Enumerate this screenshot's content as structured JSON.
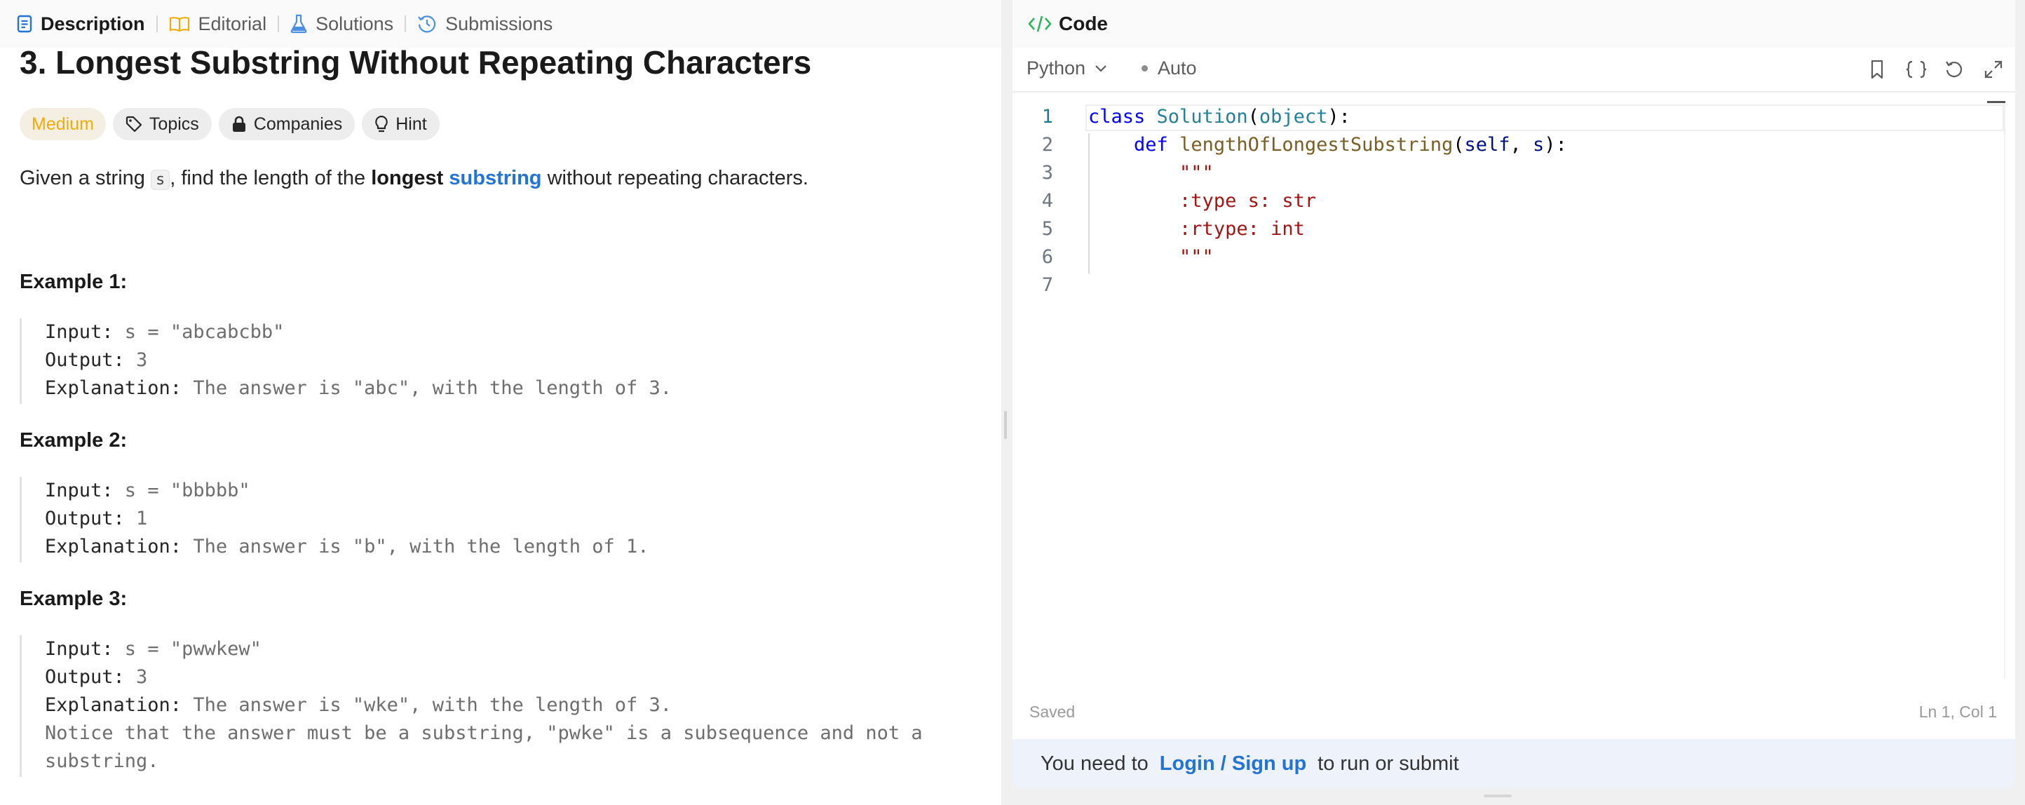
{
  "left_tabs": [
    {
      "label": "Description",
      "icon": "document-icon",
      "active": true
    },
    {
      "label": "Editorial",
      "icon": "book-icon"
    },
    {
      "label": "Solutions",
      "icon": "flask-icon"
    },
    {
      "label": "Submissions",
      "icon": "history-icon"
    }
  ],
  "problem": {
    "title": "3. Longest Substring Without Repeating Characters",
    "difficulty": "Medium",
    "chips": [
      "Topics",
      "Companies",
      "Hint"
    ],
    "desc_prefix": "Given a string ",
    "desc_code": "s",
    "desc_middle": ", find the length of the ",
    "desc_bold": "longest",
    "desc_link": "substring",
    "desc_suffix": " without repeating characters."
  },
  "examples": [
    {
      "title": "Example 1:",
      "input_label": "Input:",
      "input": " s = \"abcabcbb\"",
      "output_label": "Output:",
      "output": " 3",
      "explanation_label": "Explanation:",
      "explanation": " The answer is \"abc\", with the length of 3."
    },
    {
      "title": "Example 2:",
      "input_label": "Input:",
      "input": " s = \"bbbbb\"",
      "output_label": "Output:",
      "output": " 1",
      "explanation_label": "Explanation:",
      "explanation": " The answer is \"b\", with the length of 1."
    },
    {
      "title": "Example 3:",
      "input_label": "Input:",
      "input": " s = \"pwwkew\"",
      "output_label": "Output:",
      "output": " 3",
      "explanation_label": "Explanation:",
      "explanation": " The answer is \"wke\", with the length of 3.",
      "note_line1": "Notice that the answer must be a substring, \"pwke\" is a subsequence and not a",
      "note_line2": "substring."
    }
  ],
  "code_panel": {
    "tab_label": "Code",
    "language": "Python",
    "mode": "Auto",
    "line_numbers": [
      "1",
      "2",
      "3",
      "4",
      "5",
      "6",
      "7"
    ],
    "lines": {
      "l1_kw": "class",
      "l1_cls": "Solution",
      "l1_p1": "(",
      "l1_base": "object",
      "l1_p2": "):",
      "l2_kw": "def",
      "l2_fn": "lengthOfLongestSubstring",
      "l2_p1": "(",
      "l2_self": "self",
      "l2_comma": ", ",
      "l2_s": "s",
      "l2_p2": "):",
      "l3": "\"\"\"",
      "l4": ":type s: str",
      "l5": ":rtype: int",
      "l6": "\"\"\""
    },
    "status_saved": "Saved",
    "cursor_position": "Ln 1, Col 1",
    "login_prefix": "You need to",
    "login_link": "Login / Sign up",
    "login_suffix": "to run or submit",
    "toolbar_icons": [
      "bookmark-icon",
      "braces-icon",
      "reset-icon",
      "expand-icon"
    ]
  },
  "colors": {
    "difficulty_medium": "#f0ad0a",
    "link_blue": "#2474d6",
    "code_icon_green": "#2db55d"
  }
}
